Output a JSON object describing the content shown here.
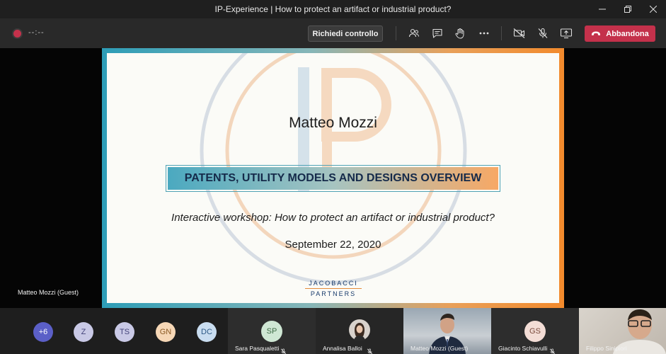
{
  "window": {
    "title": "IP-Experience | How to protect an artifact or industrial product?",
    "minimize_icon": "minimize-icon",
    "restore_icon": "restore-icon",
    "close_icon": "close-icon"
  },
  "toolbar": {
    "recording_indicator": "recording-dot",
    "timer": "--:--",
    "request_control_label": "Richiedi controllo",
    "icons": [
      "participants-icon",
      "chat-icon",
      "raise-hand-icon",
      "more-options-icon",
      "camera-off-icon",
      "mic-off-icon",
      "share-screen-icon"
    ],
    "leave_label": "Abbandona",
    "leave_icon": "phone-hangup-icon",
    "leave_color": "#c4314b"
  },
  "slide": {
    "presenter": "Matteo Mozzi",
    "heading": "PATENTS, UTILITY MODELS AND DESIGNS OVERVIEW",
    "subtitle": "Interactive workshop: How to protect an artifact or industrial product?",
    "date": "September 22, 2020",
    "logo_line1": "JACOBACCI",
    "logo_line2": "PARTNERS",
    "watermark": "IP"
  },
  "presenter_label": "Matteo Mozzi (Guest)",
  "participants": {
    "avatars": [
      {
        "initials": "+6",
        "color": "#5b5fc7",
        "text_color": "#ffffff"
      },
      {
        "initials": "Z",
        "color": "#c9c9e6",
        "text_color": "#43437a"
      },
      {
        "initials": "TS",
        "color": "#c9c9e6",
        "text_color": "#43437a"
      },
      {
        "initials": "GN",
        "color": "#f6d7b6",
        "text_color": "#8a5a24"
      },
      {
        "initials": "DC",
        "color": "#c9ddf0",
        "text_color": "#2e5a86"
      }
    ],
    "tiles": [
      {
        "name": "Sara Pasqualetti",
        "initials": "SP",
        "avatar_color": "#cfe7d4",
        "avatar_text": "#3d6b45",
        "muted": true
      },
      {
        "name": "Annalisa Balloi",
        "initials": "",
        "avatar_color": "",
        "avatar_text": "",
        "muted": true
      },
      {
        "name": "Matteo Mozzi (Guest)",
        "initials": "",
        "avatar_color": "",
        "avatar_text": "",
        "muted": false
      },
      {
        "name": "Giacinto Schiavulli",
        "initials": "GS",
        "avatar_color": "#f3ddd6",
        "avatar_text": "#7a4a3c",
        "muted": true
      },
      {
        "name": "Filippo Sinipiori",
        "initials": "",
        "avatar_color": "",
        "avatar_text": "",
        "muted": false
      }
    ]
  }
}
